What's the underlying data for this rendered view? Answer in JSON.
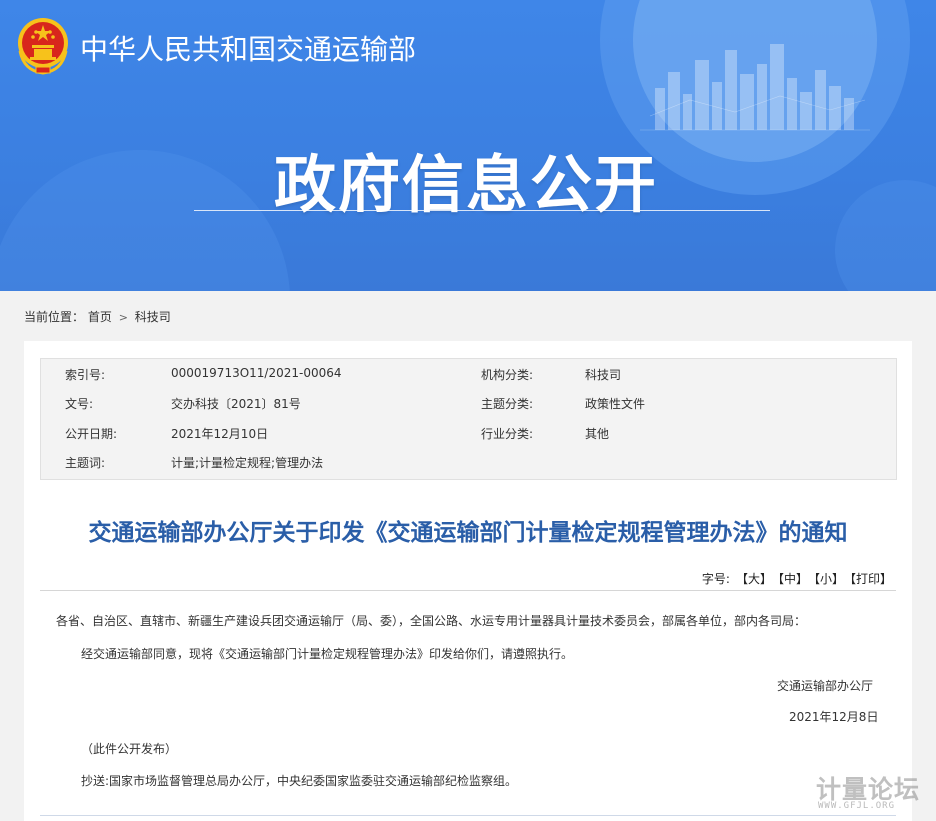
{
  "header": {
    "site_name": "中华人民共和国交通运输部",
    "banner_title": "政府信息公开"
  },
  "breadcrumb": {
    "prefix": "当前位置：",
    "home": "首页",
    "separator": ">",
    "current": "科技司"
  },
  "meta": {
    "index_label": "索引号:",
    "index_value": "000019713O11/2021-00064",
    "org_label": "机构分类:",
    "org_value": "科技司",
    "doc_no_label": "文号:",
    "doc_no_value": "交办科技〔2021〕81号",
    "topic_label": "主题分类:",
    "topic_value": "政策性文件",
    "date_label": "公开日期:",
    "date_value": "2021年12月10日",
    "industry_label": "行业分类:",
    "industry_value": "其他",
    "keywords_label": "主题词:",
    "keywords_value": "计量;计量检定规程;管理办法"
  },
  "article": {
    "title": "交通运输部办公厅关于印发《交通运输部门计量检定规程管理办法》的通知",
    "font_size_label": "字号:",
    "font_large": "【大】",
    "font_medium": "【中】",
    "font_small": "【小】",
    "print": "【打印】",
    "recipients": "各省、自治区、直辖市、新疆生产建设兵团交通运输厅（局、委），全国公路、水运专用计量器具计量技术委员会，部属各单位，部内各司局：",
    "body": "经交通运输部同意，现将《交通运输部门计量检定规程管理办法》印发给你们，请遵照执行。",
    "issuer": "交通运输部办公厅",
    "issue_date": "2021年12月8日",
    "publish_note": "（此件公开发布）",
    "cc": "抄送:国家市场监督管理总局办公厅，中央纪委国家监委驻交通运输部纪检监察组。"
  },
  "watermark": {
    "text": "计量论坛",
    "url": "WWW.GFJL.ORG"
  },
  "colors": {
    "banner_blue": "#3b7fe0",
    "title_blue": "#2a5ea8",
    "page_bg": "#f2f2f2"
  }
}
